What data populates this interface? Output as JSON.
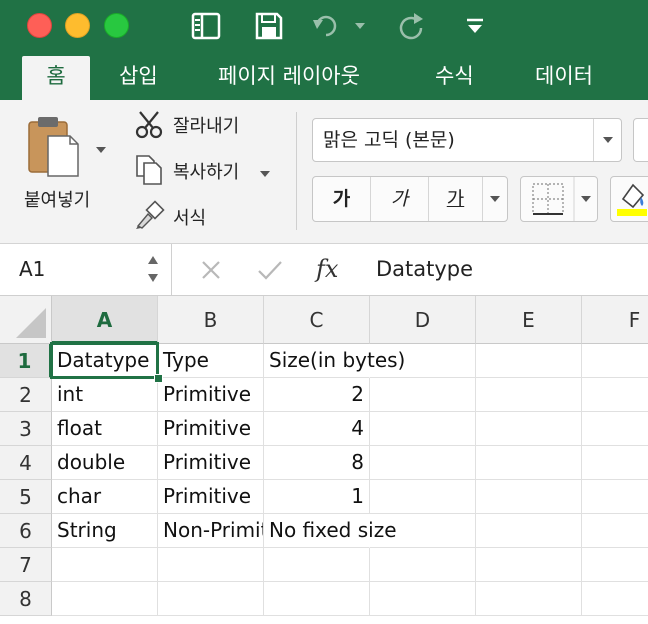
{
  "tabs": [
    "홈",
    "삽입",
    "페이지 레이아웃",
    "수식",
    "데이터"
  ],
  "clipboard": {
    "paste": "붙여넣기",
    "cut": "잘라내기",
    "copy": "복사하기",
    "format_painter": "서식"
  },
  "font": {
    "name": "맑은 고딕 (본문)",
    "bold": "가",
    "italic": "가",
    "underline": "가"
  },
  "formula_bar": {
    "name_box": "A1",
    "fx": "fx",
    "value": "Datatype"
  },
  "grid": {
    "columns": [
      "A",
      "B",
      "C",
      "D",
      "E",
      "F"
    ],
    "rows": [
      "1",
      "2",
      "3",
      "4",
      "5",
      "6",
      "7",
      "8"
    ],
    "cells": [
      [
        "Datatype",
        "Type",
        "Size(in bytes)"
      ],
      [
        "int",
        "Primitive",
        "2"
      ],
      [
        "float",
        "Primitive",
        "4"
      ],
      [
        "double",
        "Primitive",
        "8"
      ],
      [
        "char",
        "Primitive",
        "1"
      ],
      [
        "String",
        "Non-Primitive",
        "No fixed size"
      ]
    ],
    "selected_cell": "A1"
  },
  "colors": {
    "accent": "#207245",
    "active_tab_text": "#1e6b3f"
  }
}
